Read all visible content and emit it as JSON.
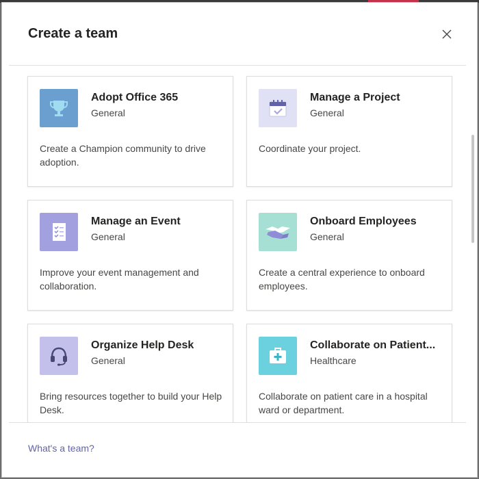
{
  "dialog": {
    "title": "Create a team",
    "close_icon": "close-icon",
    "footer_link": "What's a team?"
  },
  "cards": [
    {
      "title": "Adopt Office 365",
      "category": "General",
      "description": "Create a Champion community to drive adoption.",
      "icon": "trophy-icon",
      "icon_bg": "#6a9fd0"
    },
    {
      "title": "Manage a Project",
      "category": "General",
      "description": "Coordinate your project.",
      "icon": "calendar-icon",
      "icon_bg": "#e1e1f5"
    },
    {
      "title": "Manage an Event",
      "category": "General",
      "description": "Improve your event management and collaboration.",
      "icon": "checklist-icon",
      "icon_bg": "#a3a0e0"
    },
    {
      "title": "Onboard Employees",
      "category": "General",
      "description": "Create a central experience to onboard employees.",
      "icon": "handshake-icon",
      "icon_bg": "#a6e0d5"
    },
    {
      "title": "Organize Help Desk",
      "category": "General",
      "description": "Bring resources together to build your Help Desk.",
      "icon": "headset-icon",
      "icon_bg": "#c4c0ec"
    },
    {
      "title": "Collaborate on Patient...",
      "category": "Healthcare",
      "description": "Collaborate on patient care in a hospital ward or department.",
      "icon": "medical-kit-icon",
      "icon_bg": "#6cd1de"
    }
  ]
}
